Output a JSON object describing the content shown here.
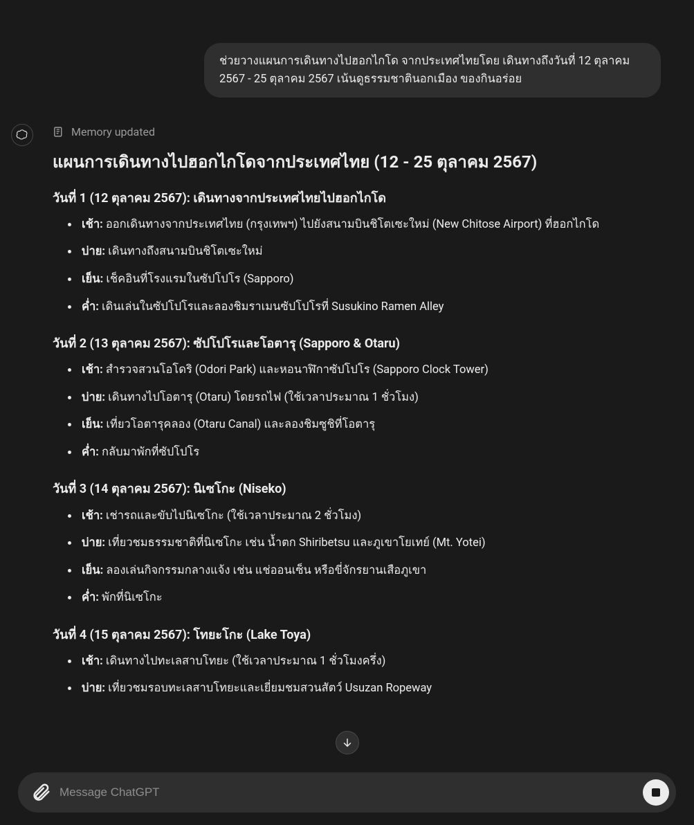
{
  "user_message": "ช่วยวางแผนการเดินทางไปฮอกไกโด จากประเทศไทยโดย เดินทางถึงวันที่ 12 ตุลาคม 2567 - 25 ตุลาคม 2567 เน้นดูธรรมชาตินอกเมือง ของกินอร่อย",
  "memory_status": "Memory updated",
  "plan_title": "แผนการเดินทางไปฮอกไกโดจากประเทศไทย (12 - 25 ตุลาคม 2567)",
  "days": [
    {
      "heading": "วันที่ 1 (12 ตุลาคม 2567): เดินทางจากประเทศไทยไปฮอกไกโด",
      "items": [
        {
          "label": "เช้า:",
          "text": " ออกเดินทางจากประเทศไทย (กรุงเทพฯ) ไปยังสนามบินชิโตเซะใหม่ (New Chitose Airport) ที่ฮอกไกโด"
        },
        {
          "label": "บ่าย:",
          "text": " เดินทางถึงสนามบินชิโตเซะใหม่"
        },
        {
          "label": "เย็น:",
          "text": " เช็คอินที่โรงแรมในซัปโปโร (Sapporo)"
        },
        {
          "label": "ค่ำ:",
          "text": " เดินเล่นในซัปโปโรและลองชิมราเมนซัปโปโรที่ Susukino Ramen Alley"
        }
      ]
    },
    {
      "heading": "วันที่ 2 (13 ตุลาคม 2567): ซัปโปโรและโอตารุ (Sapporo & Otaru)",
      "items": [
        {
          "label": "เช้า:",
          "text": " สำรวจสวนโอโดริ (Odori Park) และหอนาฬิกาซัปโปโร (Sapporo Clock Tower)"
        },
        {
          "label": "บ่าย:",
          "text": " เดินทางไปโอตารุ (Otaru) โดยรถไฟ (ใช้เวลาประมาณ 1 ชั่วโมง)"
        },
        {
          "label": "เย็น:",
          "text": " เที่ยวโอตารุคลอง (Otaru Canal) และลองชิมซูชิที่โอตารุ"
        },
        {
          "label": "ค่ำ:",
          "text": " กลับมาพักที่ซัปโปโร"
        }
      ]
    },
    {
      "heading": "วันที่ 3 (14 ตุลาคม 2567): นิเซโกะ (Niseko)",
      "items": [
        {
          "label": "เช้า:",
          "text": " เช่ารถและขับไปนิเซโกะ (ใช้เวลาประมาณ 2 ชั่วโมง)"
        },
        {
          "label": "บ่าย:",
          "text": " เที่ยวชมธรรมชาติที่นิเซโกะ เช่น น้ำตก Shiribetsu และภูเขาโยเทย์ (Mt. Yotei)"
        },
        {
          "label": "เย็น:",
          "text": " ลองเล่นกิจกรรมกลางแจ้ง เช่น แช่ออนเซ็น หรือขี่จักรยานเสือภูเขา"
        },
        {
          "label": "ค่ำ:",
          "text": " พักที่นิเซโกะ"
        }
      ]
    },
    {
      "heading": "วันที่ 4 (15 ตุลาคม 2567): โทยะโกะ (Lake Toya)",
      "items": [
        {
          "label": "เช้า:",
          "text": " เดินทางไปทะเลสาบโทยะ (ใช้เวลาประมาณ 1 ชั่วโมงครึ่ง)"
        },
        {
          "label": "บ่าย:",
          "text": " เที่ยวชมรอบทะเลสาบโทยะและเยี่ยมชมสวนสัตว์ Usuzan Ropeway"
        }
      ]
    }
  ],
  "composer_placeholder": "Message ChatGPT"
}
